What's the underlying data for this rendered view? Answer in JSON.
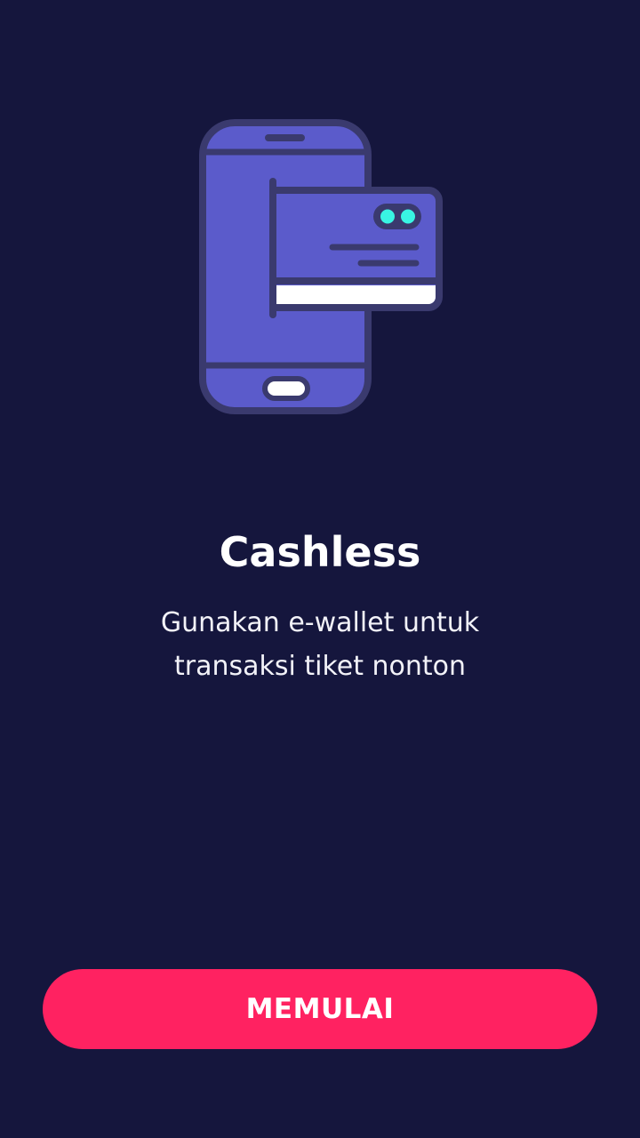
{
  "onboarding": {
    "title": "Cashless",
    "subtitle": "Gunakan e-wallet untuk transaksi tiket nonton",
    "button_label": "MEMULAI",
    "illustration_icon": "phone-with-card-icon"
  },
  "colors": {
    "background": "#15163d",
    "accent": "#ff2261",
    "phone_body": "#5b5bcb",
    "outline": "#3a3a6e",
    "card_chip": "#39f5e3"
  }
}
